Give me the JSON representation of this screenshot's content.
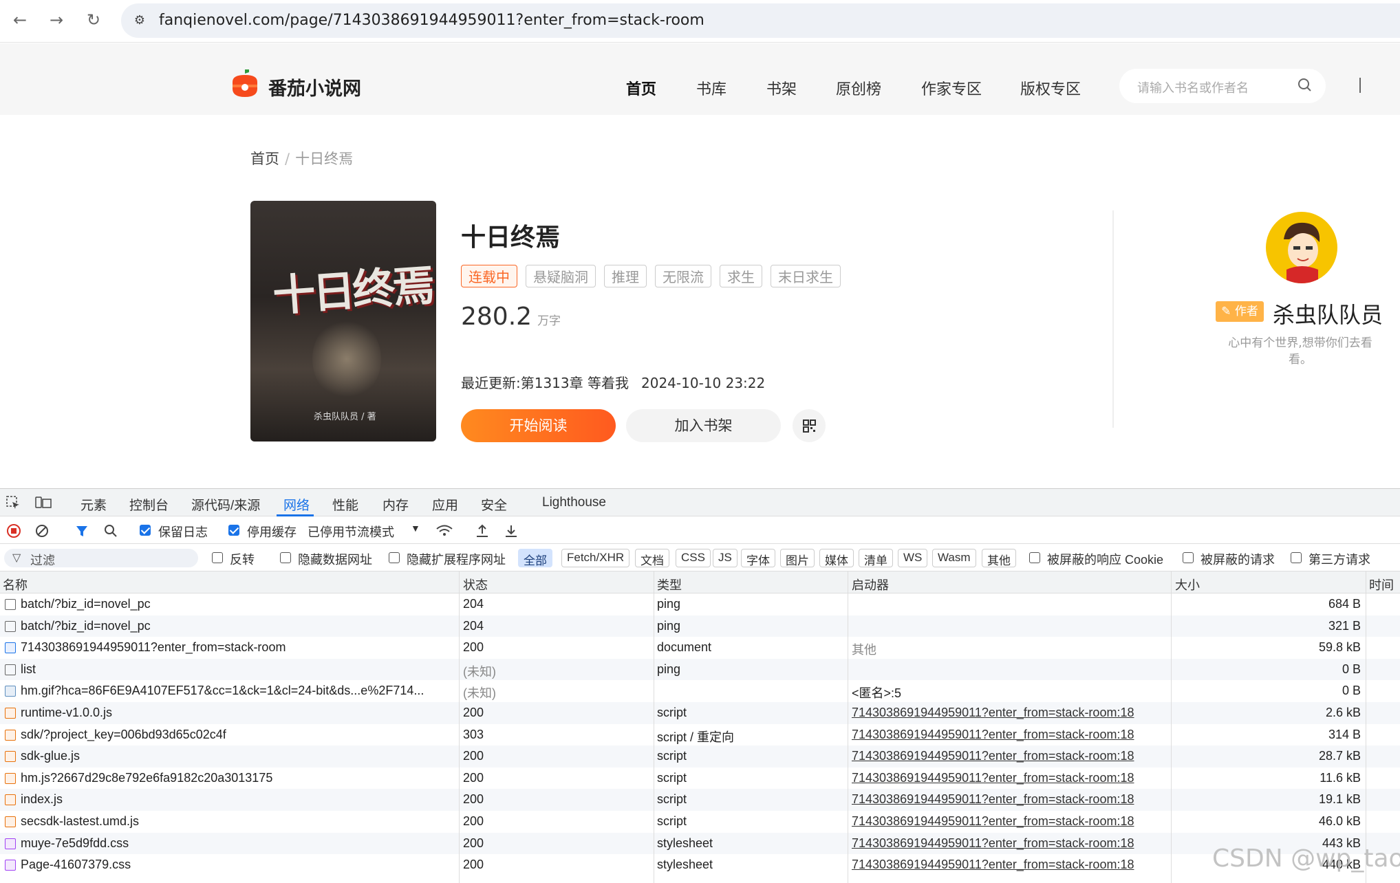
{
  "browser": {
    "url": "fanqienovel.com/page/7143038691944959011?enter_from=stack-room"
  },
  "site": {
    "logo_text": "番茄小说网",
    "nav": [
      "首页",
      "书库",
      "书架",
      "原创榜",
      "作家专区",
      "版权专区"
    ],
    "search_placeholder": "请输入书名或作者名"
  },
  "breadcrumb": {
    "home": "首页",
    "sep": "/",
    "current": "十日终焉"
  },
  "book": {
    "cover_title": "十日终焉",
    "cover_author": "杀虫队队员 / 著",
    "title": "十日终焉",
    "status": "连载中",
    "tags": [
      "悬疑脑洞",
      "推理",
      "无限流",
      "求生",
      "末日求生"
    ],
    "word_count": "280.2",
    "word_unit": "万字",
    "last_update_label": "最近更新:第1313章 等着我",
    "last_update_time": "2024-10-10 23:22",
    "read_button": "开始阅读",
    "shelf_button": "加入书架"
  },
  "author": {
    "tag": "作者",
    "name": "杀虫队队员",
    "desc": "心中有个世界,想带你们去看看。"
  },
  "devtools": {
    "tabs": [
      "元素",
      "控制台",
      "源代码/来源",
      "网络",
      "性能",
      "内存",
      "应用",
      "安全",
      "Lighthouse"
    ],
    "active_tab": "网络",
    "toolbar": {
      "preserve_log": "保留日志",
      "disable_cache": "停用缓存",
      "throttling": "已停用节流模式"
    },
    "filter": {
      "placeholder": "过滤",
      "invert": "反转",
      "hide_data_urls": "隐藏数据网址",
      "hide_ext_urls": "隐藏扩展程序网址",
      "types": [
        "全部",
        "Fetch/XHR",
        "文档",
        "CSS",
        "JS",
        "字体",
        "图片",
        "媒体",
        "清单",
        "WS",
        "Wasm",
        "其他"
      ],
      "blocked_cookies": "被屏蔽的响应 Cookie",
      "blocked_requests": "被屏蔽的请求",
      "third_party": "第三方请求"
    },
    "columns": [
      "名称",
      "状态",
      "类型",
      "启动器",
      "大小",
      "时间"
    ],
    "rows": [
      {
        "icon": "box",
        "name": "batch/?biz_id=novel_pc",
        "status": "204",
        "type": "ping",
        "initiator": "",
        "size": "684 B"
      },
      {
        "icon": "box",
        "name": "batch/?biz_id=novel_pc",
        "status": "204",
        "type": "ping",
        "initiator": "",
        "size": "321 B"
      },
      {
        "icon": "doc",
        "name": "7143038691944959011?enter_from=stack-room",
        "status": "200",
        "type": "document",
        "initiator": "其他",
        "size": "59.8 kB"
      },
      {
        "icon": "box",
        "name": "list",
        "status": "(未知)",
        "type": "ping",
        "initiator": "",
        "size": "0 B"
      },
      {
        "icon": "img",
        "name": "hm.gif?hca=86F6E9A4107EF517&cc=1&ck=1&cl=24-bit&ds...e%2F714...",
        "status": "(未知)",
        "type": "",
        "initiator": "<匿名>:5",
        "size": "0 B"
      },
      {
        "icon": "script",
        "name": "runtime-v1.0.0.js",
        "status": "200",
        "type": "script",
        "initiator": "7143038691944959011?enter_from=stack-room:18",
        "size": "2.6 kB"
      },
      {
        "icon": "script",
        "name": "sdk/?project_key=006bd93d65c02c4f",
        "status": "303",
        "type": "script / 重定向",
        "initiator": "7143038691944959011?enter_from=stack-room:18",
        "size": "314 B"
      },
      {
        "icon": "script",
        "name": "sdk-glue.js",
        "status": "200",
        "type": "script",
        "initiator": "7143038691944959011?enter_from=stack-room:18",
        "size": "28.7 kB"
      },
      {
        "icon": "script",
        "name": "hm.js?2667d29c8e792e6fa9182c20a3013175",
        "status": "200",
        "type": "script",
        "initiator": "7143038691944959011?enter_from=stack-room:18",
        "size": "11.6 kB"
      },
      {
        "icon": "script",
        "name": "index.js",
        "status": "200",
        "type": "script",
        "initiator": "7143038691944959011?enter_from=stack-room:18",
        "size": "19.1 kB"
      },
      {
        "icon": "script",
        "name": "secsdk-lastest.umd.js",
        "status": "200",
        "type": "script",
        "initiator": "7143038691944959011?enter_from=stack-room:18",
        "size": "46.0 kB"
      },
      {
        "icon": "css",
        "name": "muye-7e5d9fdd.css",
        "status": "200",
        "type": "stylesheet",
        "initiator": "7143038691944959011?enter_from=stack-room:18",
        "size": "443 kB"
      },
      {
        "icon": "css",
        "name": "Page-41607379.css",
        "status": "200",
        "type": "stylesheet",
        "initiator": "7143038691944959011?enter_from=stack-room:18",
        "size": "440 kB"
      }
    ]
  },
  "watermark": "CSDN @wp_tao"
}
